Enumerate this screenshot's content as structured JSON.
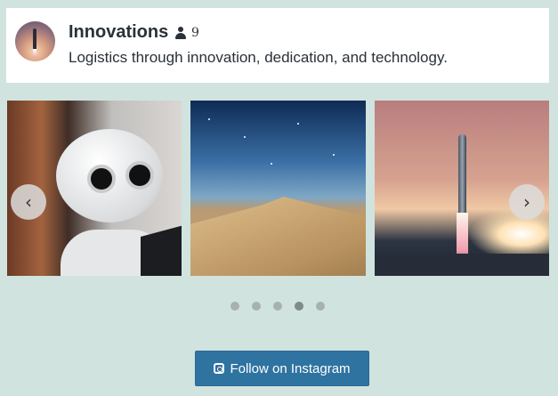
{
  "header": {
    "title": "Innovations",
    "followers_count": "9",
    "description": "Logistics through innovation, dedication, and technology."
  },
  "carousel": {
    "prev_label": "‹",
    "next_label": "›",
    "slides": [
      {
        "name": "robot-image"
      },
      {
        "name": "desert-image"
      },
      {
        "name": "rocket-image"
      }
    ],
    "dots_count": 5,
    "active_dot": 4
  },
  "follow_button": {
    "label": "Follow on Instagram"
  },
  "colors": {
    "background": "#d1e3de",
    "button": "#2f73a1"
  },
  "icons": [
    "user-icon",
    "instagram-icon",
    "chevron-left-icon",
    "chevron-right-icon"
  ]
}
